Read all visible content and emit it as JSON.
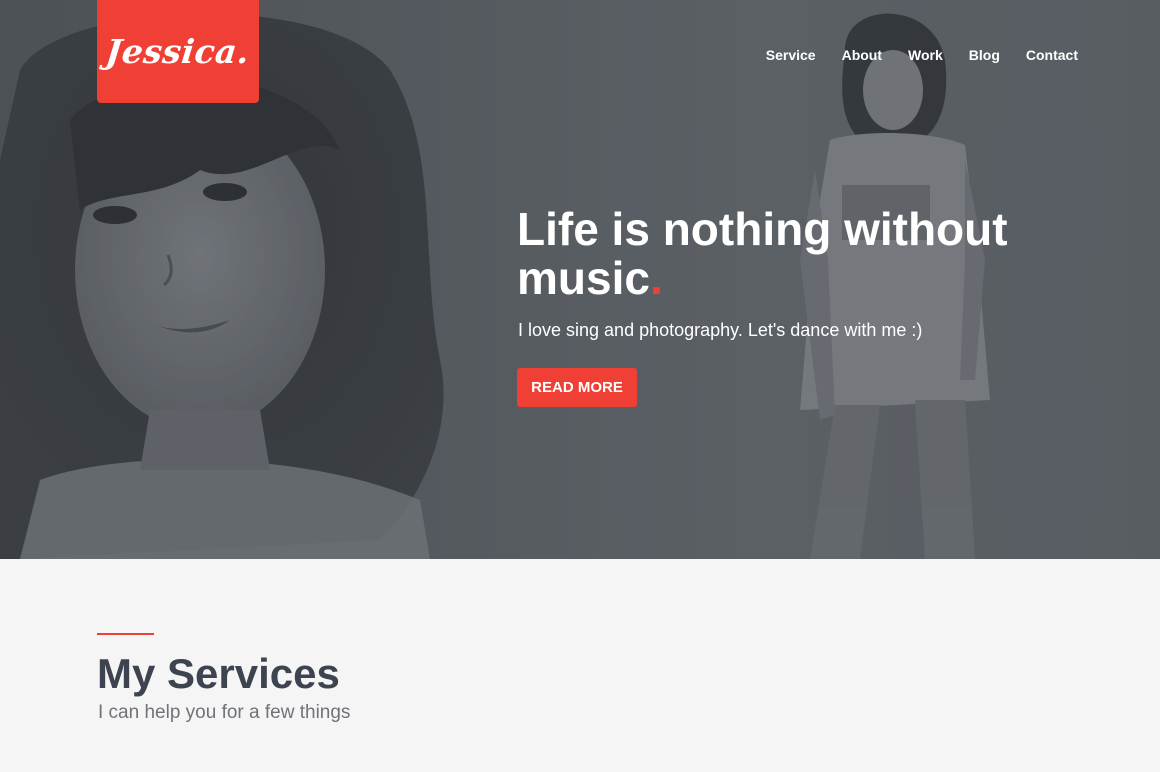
{
  "brand": {
    "logo_text": "Jessica.",
    "accent_color": "#f03f35"
  },
  "nav": {
    "items": [
      {
        "label": "Service"
      },
      {
        "label": "About"
      },
      {
        "label": "Work"
      },
      {
        "label": "Blog"
      },
      {
        "label": "Contact"
      }
    ]
  },
  "hero": {
    "title": "Life is nothing without music",
    "title_dot": ".",
    "subtitle": "I love sing and photography. Let's dance with me :)",
    "cta_label": "READ MORE"
  },
  "services": {
    "title": "My Services",
    "subtitle": "I can help you for a few things"
  }
}
